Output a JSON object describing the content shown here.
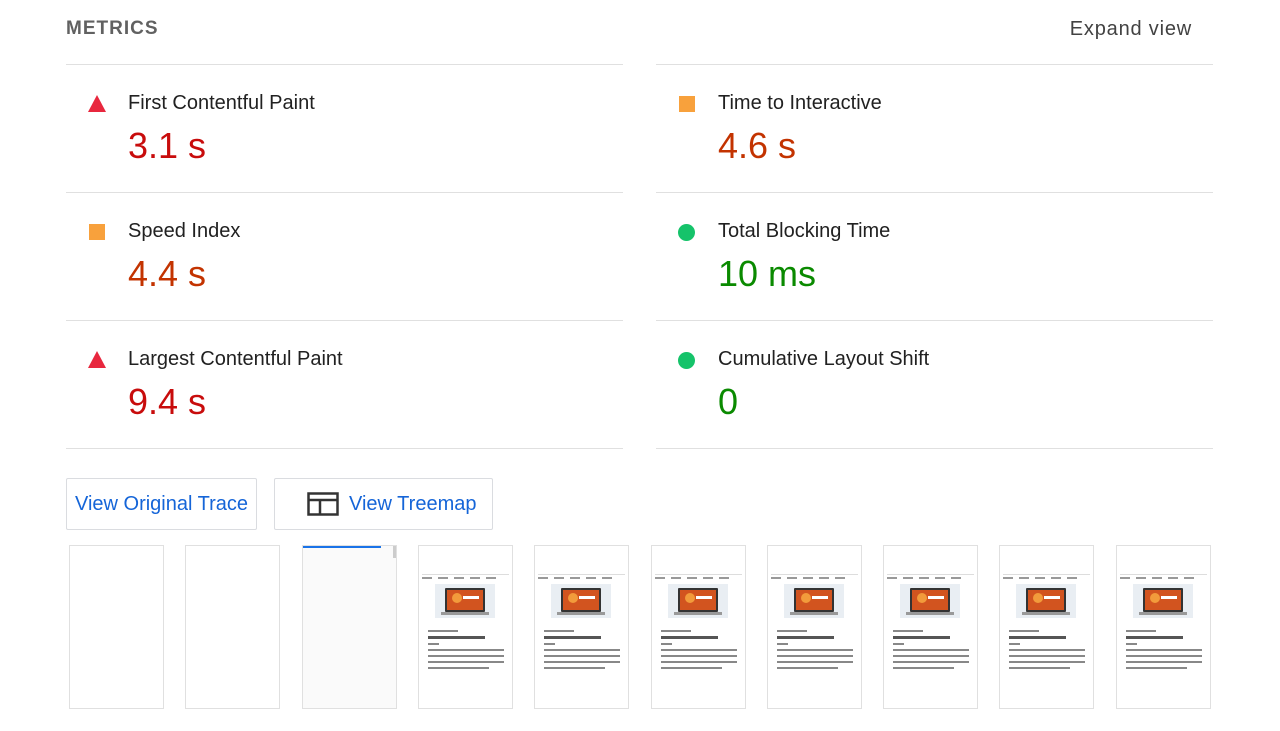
{
  "header": {
    "title": "METRICS",
    "expand_label": "Expand view"
  },
  "metrics": {
    "left": [
      {
        "label": "First Contentful Paint",
        "value": "3.1 s",
        "status": "fail",
        "icon": "triangle-icon",
        "color": "#c80c0c"
      },
      {
        "label": "Speed Index",
        "value": "4.4 s",
        "status": "average",
        "icon": "square-icon",
        "color": "#c33300"
      },
      {
        "label": "Largest Contentful Paint",
        "value": "9.4 s",
        "status": "fail",
        "icon": "triangle-icon",
        "color": "#c80c0c"
      }
    ],
    "right": [
      {
        "label": "Time to Interactive",
        "value": "4.6 s",
        "status": "average",
        "icon": "square-icon",
        "color": "#c33300"
      },
      {
        "label": "Total Blocking Time",
        "value": "10 ms",
        "status": "pass",
        "icon": "circle-icon",
        "color": "#0a8a00"
      },
      {
        "label": "Cumulative Layout Shift",
        "value": "0",
        "status": "pass",
        "icon": "circle-icon",
        "color": "#0a8a00"
      }
    ]
  },
  "buttons": {
    "trace_label": "View Original Trace",
    "treemap_label": "View Treemap"
  },
  "colors": {
    "fail": "#e8273e",
    "average": "#f8a13c",
    "pass": "#15c36a",
    "link": "#1565d8"
  },
  "filmstrip": {
    "frame_states": [
      "blank",
      "blank",
      "loading",
      "loaded",
      "loaded",
      "loaded",
      "loaded",
      "loaded",
      "loaded",
      "loaded"
    ]
  }
}
